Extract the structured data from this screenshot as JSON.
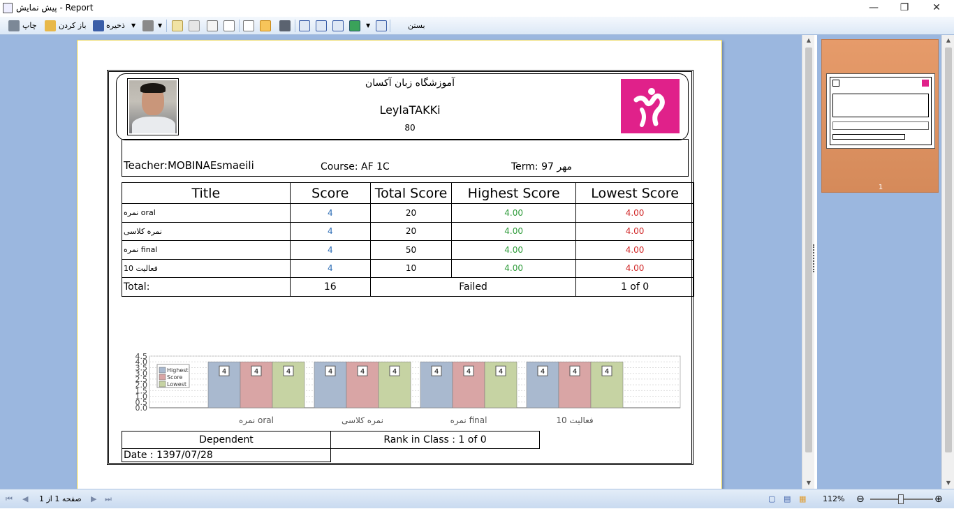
{
  "window": {
    "title": "پیش نمایش - Report",
    "controls": {
      "minimize": "—",
      "maximize": "❐",
      "close": "✕"
    }
  },
  "toolbar": {
    "print_label": "چاپ",
    "open_label": "باز کردن",
    "save_label": "ذخیره",
    "close_label": "بستن"
  },
  "report": {
    "school_name": "آموزشگاه زبان آکسان",
    "student_name": "LeylaTAKKi",
    "student_code": "80",
    "teacher": "Teacher:MOBINAEsmaeili",
    "course": "Course: AF 1C",
    "term": "Term:  97 مهر",
    "table": {
      "headers": [
        "Title",
        "Score",
        "Total Score",
        "Highest Score",
        "Lowest Score"
      ],
      "rows": [
        {
          "title": "نمره oral",
          "score": "4",
          "total": "20",
          "highest": "4.00",
          "lowest": "4.00"
        },
        {
          "title": "نمره کلاسی",
          "score": "4",
          "total": "20",
          "highest": "4.00",
          "lowest": "4.00"
        },
        {
          "title": "نمره final",
          "score": "4",
          "total": "50",
          "highest": "4.00",
          "lowest": "4.00"
        },
        {
          "title": "فعالیت 10",
          "score": "4",
          "total": "10",
          "highest": "4.00",
          "lowest": "4.00"
        }
      ],
      "total_label": "Total:",
      "total_score": "16",
      "status": "Failed",
      "rank": "1 of 0"
    },
    "dependent_label": "Dependent",
    "rank_in_class": "Rank in Class : 1 of 0",
    "date": "Date : 1397/07/28"
  },
  "chart_data": {
    "type": "bar",
    "categories": [
      "نمره oral",
      "نمره کلاسی",
      "نمره final",
      "فعالیت 10"
    ],
    "series": [
      {
        "name": "Highest",
        "values": [
          4,
          4,
          4,
          4
        ],
        "color": "#a9b9cf"
      },
      {
        "name": "Score",
        "values": [
          4,
          4,
          4,
          4
        ],
        "color": "#d9a5a5"
      },
      {
        "name": "Lowest",
        "values": [
          4,
          4,
          4,
          4
        ],
        "color": "#c6d3a3"
      }
    ],
    "ylim": [
      0,
      4.5
    ],
    "yticks": [
      "0.0",
      "0.5",
      "1.0",
      "1.5",
      "2.0",
      "2.5",
      "3.0",
      "3.5",
      "4.0",
      "4.5"
    ],
    "legend": "top-left",
    "grid": true
  },
  "thumbnail": {
    "page_number": "1"
  },
  "status": {
    "page_label": "صفحه 1 از 1",
    "zoom": "112%"
  }
}
